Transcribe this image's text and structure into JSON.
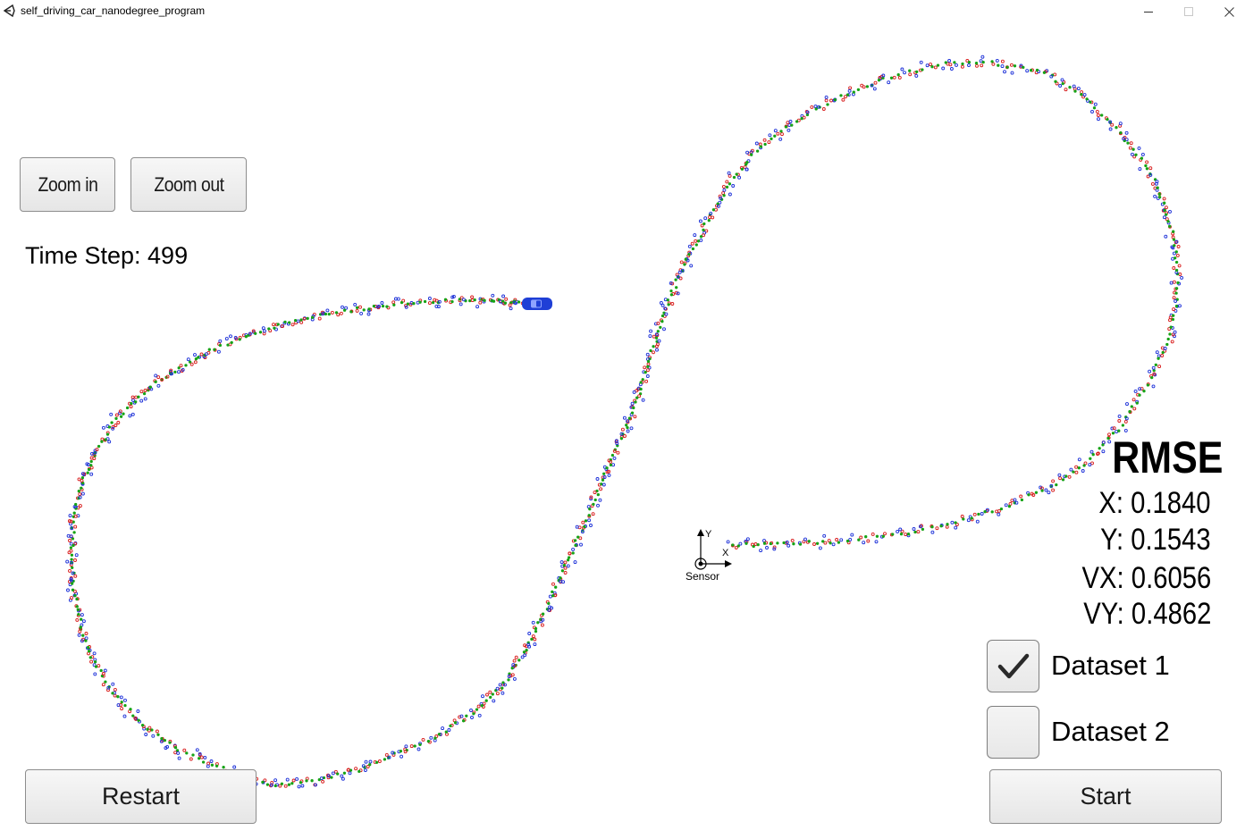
{
  "window": {
    "title": "self_driving_car_nanodegree_program",
    "icon": "unity-logo-icon"
  },
  "controls": {
    "zoom_in_label": "Zoom in",
    "zoom_out_label": "Zoom out",
    "restart_label": "Restart",
    "start_label": "Start"
  },
  "status": {
    "time_step_text": "Time Step: 499"
  },
  "rmse": {
    "title": "RMSE",
    "x": "X: 0.1840",
    "y": "Y: 0.1543",
    "vx": "VX: 0.6056",
    "vy": "VY: 0.4862"
  },
  "datasets": [
    {
      "label": "Dataset 1",
      "checked": true
    },
    {
      "label": "Dataset 2",
      "checked": false
    }
  ],
  "sensor": {
    "label": "Sensor",
    "y_axis": "Y",
    "x_axis": "X"
  },
  "colors": {
    "car": "#1f3fd6",
    "lidar_marker": "#d81b1b",
    "radar_marker": "#1b2fd8",
    "estimate_marker": "#16a316"
  }
}
